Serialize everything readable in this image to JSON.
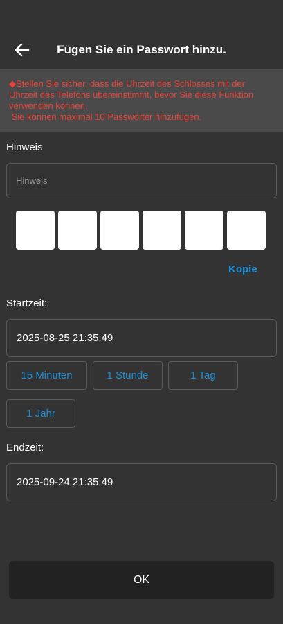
{
  "header": {
    "title": "Fügen Sie ein Passwort hinzu.",
    "back_icon": "arrow-left-icon"
  },
  "warning": {
    "color": "#e8423a",
    "lines": [
      "◆Stellen Sie sicher, dass die Uhrzeit des Schlosses mit der",
      "Uhrzeit des Telefons übereinstimmt, bevor Sie diese Funktion",
      "verwenden können.",
      " Sie können maximal 10 Passwörter hinzufügen."
    ]
  },
  "hint": {
    "label": "Hinweis",
    "placeholder": "Hinweis",
    "value": ""
  },
  "code": {
    "digits": [
      "",
      "",
      "",
      "",
      "",
      ""
    ],
    "copy_label": "Kopie"
  },
  "start": {
    "label": "Startzeit:",
    "value": "2025-08-25 21:35:49"
  },
  "durations": [
    "15 Minuten",
    "1 Stunde",
    "1 Tag",
    "1 Jahr"
  ],
  "end": {
    "label": "Endzeit:",
    "value": "2025-09-24 21:35:49"
  },
  "ok_label": "OK",
  "colors": {
    "accent": "#1e90d6",
    "background": "#333333",
    "warning_bg": "#4a4a4a"
  }
}
